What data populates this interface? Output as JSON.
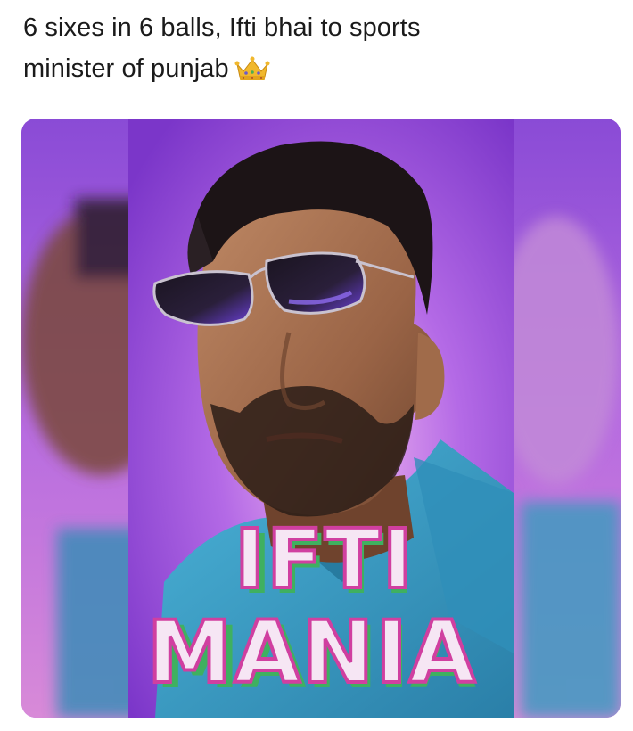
{
  "post": {
    "text_line1": "6 sixes in 6 balls, Ifti bhai to sports",
    "text_line2": "minister of punjab",
    "emoji": "crown-icon"
  },
  "poster": {
    "title_line1": "IFTI",
    "title_line2": "MANIA"
  },
  "colors": {
    "background_purple": "#9b4fe0",
    "shirt_blue": "#3aa0c8",
    "title_fill": "#f6e6f4",
    "title_outline": "#d03fa0",
    "title_shadow": "#3fb060"
  }
}
